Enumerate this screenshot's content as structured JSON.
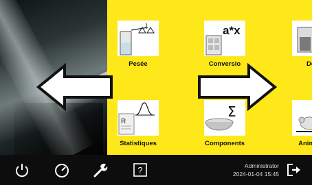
{
  "apps": [
    {
      "label": "Pesée",
      "icon": "balance-icon"
    },
    {
      "label": "Conversio",
      "icon": "conversion-icon"
    },
    {
      "label": "Den",
      "icon": "density-icon"
    },
    {
      "label": "Statistiques",
      "icon": "statistics-icon"
    },
    {
      "label": "Components",
      "icon": "components-icon"
    },
    {
      "label": "Animal w",
      "icon": "animal-weighing-icon"
    }
  ],
  "conversion_glyph": "a*x",
  "components_glyph": "Σ",
  "statistics_glyph": "R",
  "taskbar": {
    "user": "Administrator",
    "datetime": "2024-01-04 15:45",
    "buttons": [
      "power-icon",
      "speedometer-icon",
      "wrench-icon",
      "help-icon",
      "logout-icon"
    ],
    "help_glyph": "?"
  },
  "colors": {
    "accent": "#ffe81a",
    "taskbar": "#0d0d0d"
  }
}
